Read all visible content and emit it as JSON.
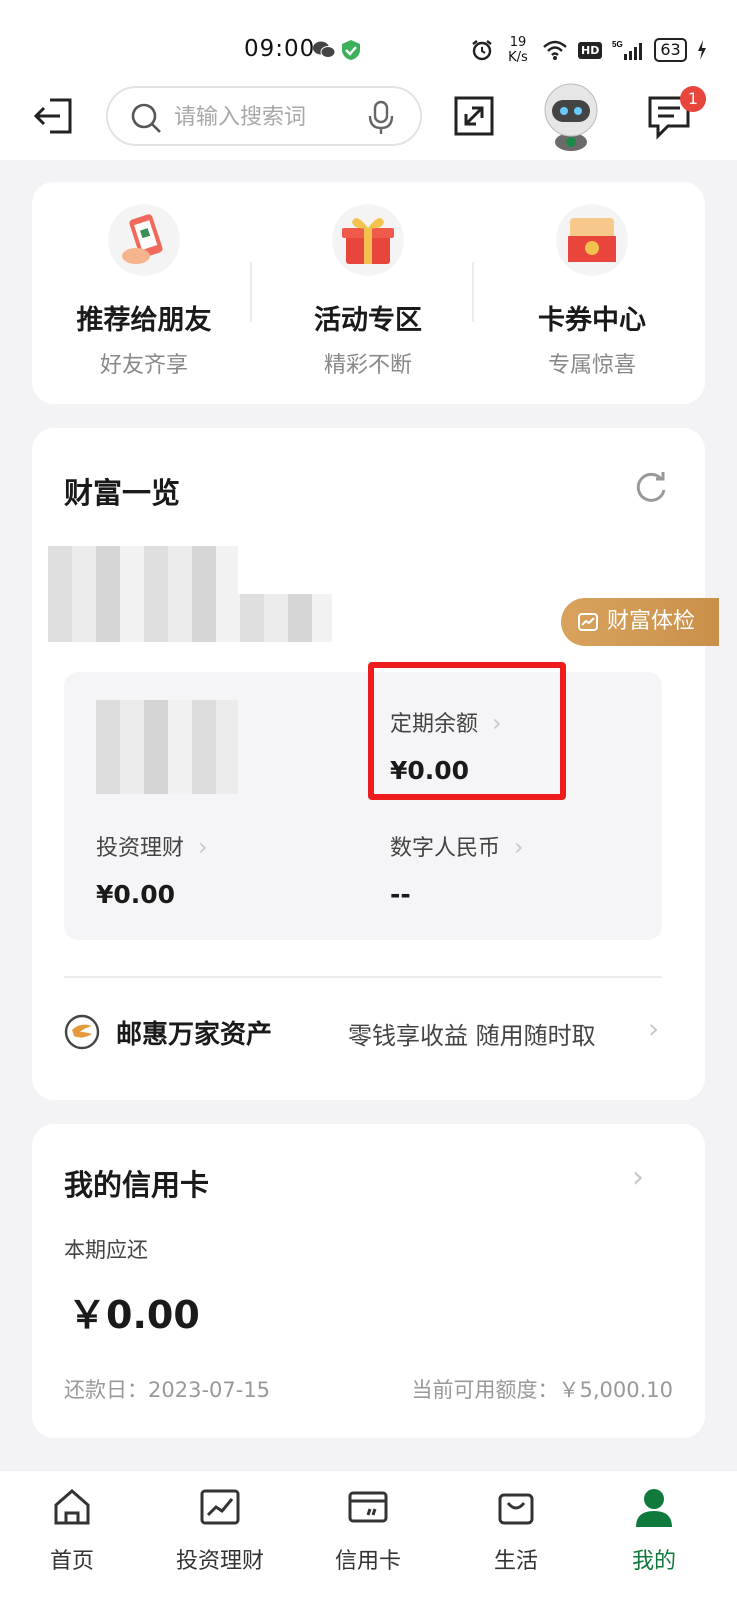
{
  "status_bar": {
    "time": "09:00",
    "speed": "19\nK/s",
    "network": "5G",
    "hd": "HD",
    "battery": "63"
  },
  "header": {
    "search_placeholder": "请输入搜索词",
    "message_badge": "1"
  },
  "quick_actions": [
    {
      "title": "推荐给朋友",
      "subtitle": "好友齐享"
    },
    {
      "title": "活动专区",
      "subtitle": "精彩不断"
    },
    {
      "title": "卡券中心",
      "subtitle": "专属惊喜"
    }
  ],
  "wealth": {
    "title": "财富一览",
    "checkup_label": "财富体检",
    "fixed_balance": {
      "label": "定期余额",
      "value": "¥0.00"
    },
    "investment": {
      "label": "投资理财",
      "value": "¥0.00"
    },
    "digital_rmb": {
      "label": "数字人民币",
      "value": "--"
    },
    "promo": {
      "name": "邮惠万家资产",
      "desc": "零钱享收益 随用随时取"
    }
  },
  "credit_card": {
    "title": "我的信用卡",
    "due_label": "本期应还",
    "amount": "￥0.00",
    "due_date": "还款日：2023-07-15",
    "available_limit": "当前可用额度：￥5,000.10"
  },
  "bottom_nav": [
    {
      "label": "首页",
      "icon": "home-icon"
    },
    {
      "label": "投资理财",
      "icon": "chart-icon"
    },
    {
      "label": "信用卡",
      "icon": "card-icon"
    },
    {
      "label": "生活",
      "icon": "bag-icon"
    },
    {
      "label": "我的",
      "icon": "profile-icon"
    }
  ],
  "colors": {
    "accent_green": "#0f7a3b",
    "highlight_red": "#ee1c1c",
    "checkup_gold": "#d9a35d",
    "badge_red": "#e8453c"
  }
}
